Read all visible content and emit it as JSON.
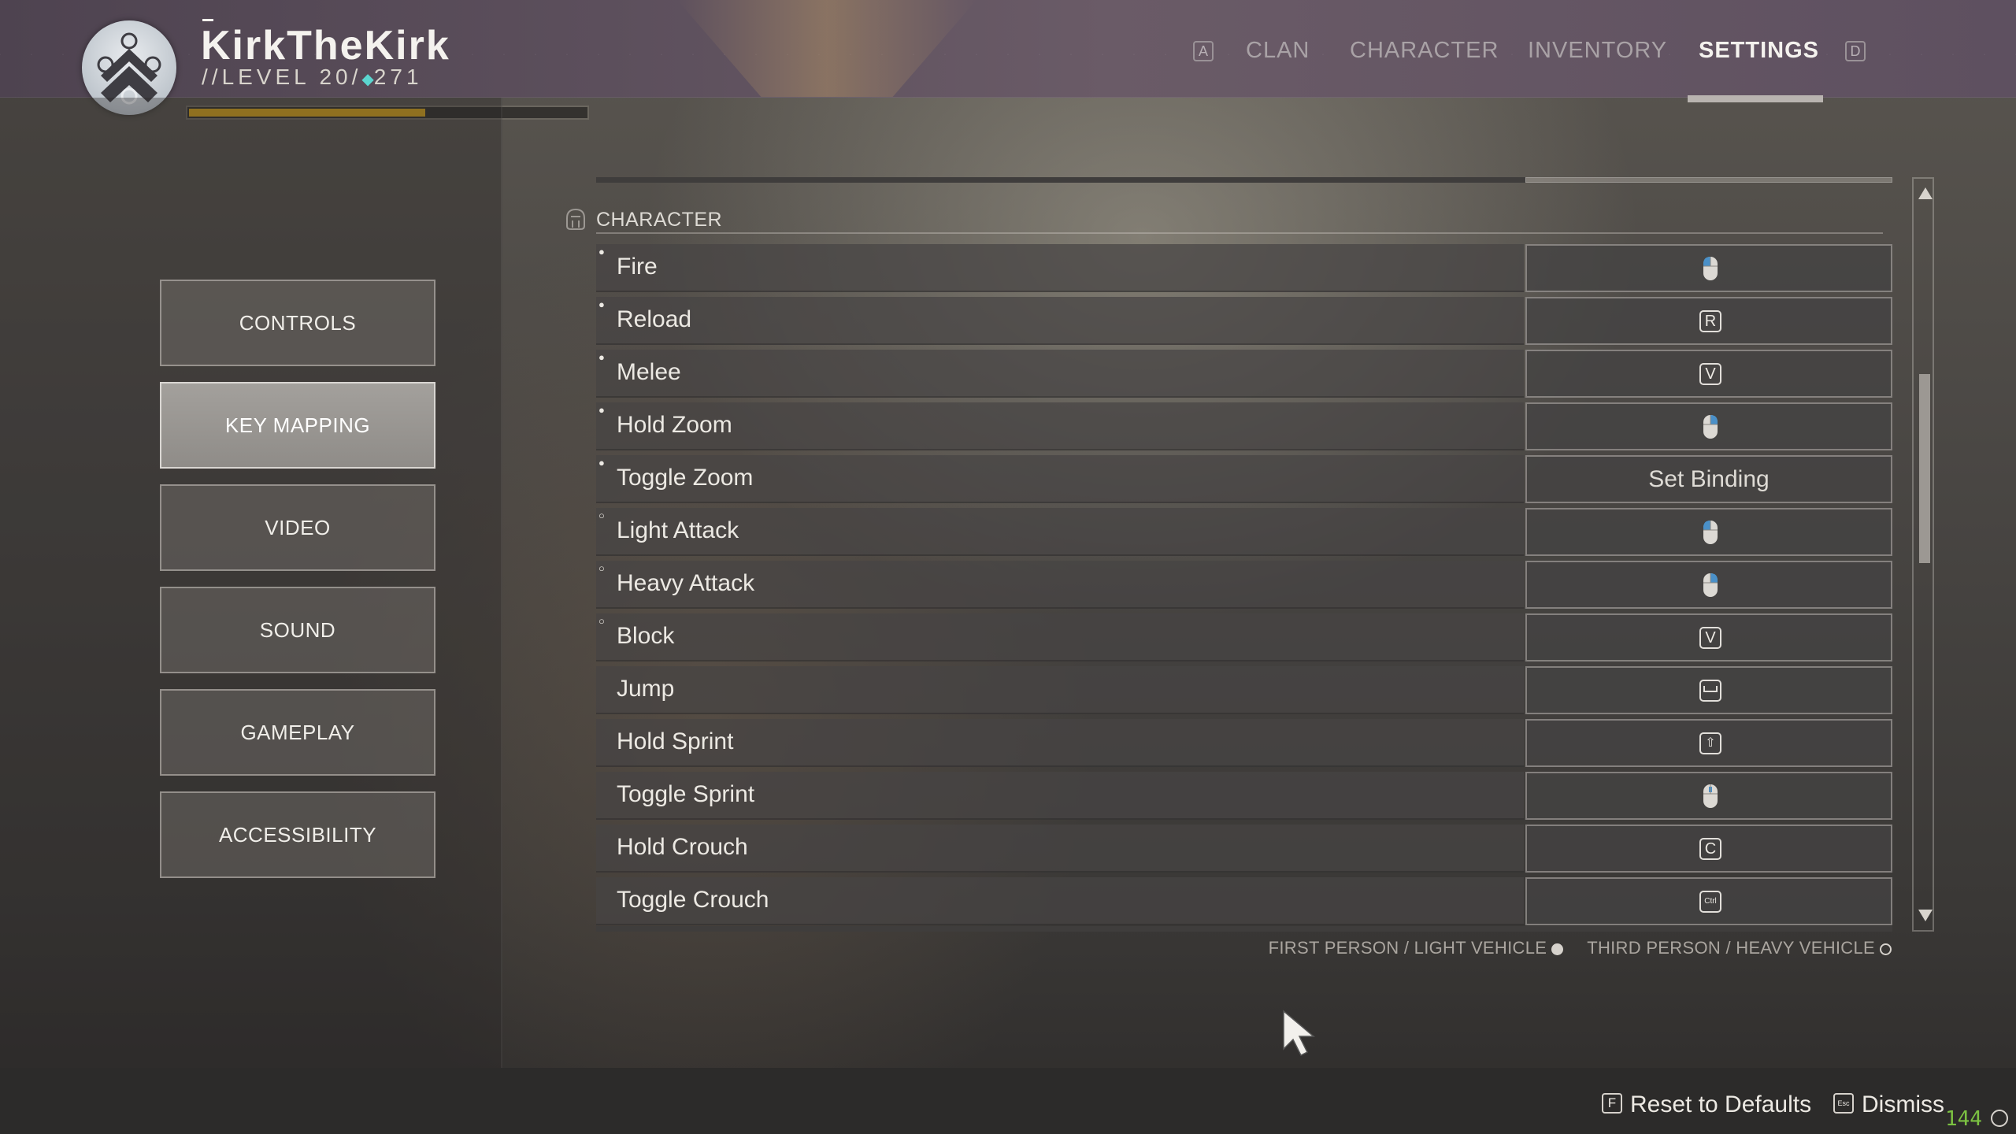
{
  "header": {
    "player_name": "KirkTheKirk",
    "level_prefix": "//",
    "level_text": "LEVEL 20/",
    "power_icon": "diamond-icon",
    "power": "271",
    "xp_progress": 0.59,
    "nav_left_key": "A",
    "nav_right_key": "D",
    "tabs": [
      {
        "label": "CLAN"
      },
      {
        "label": "CHARACTER"
      },
      {
        "label": "INVENTORY"
      },
      {
        "label": "SETTINGS",
        "active": true
      }
    ]
  },
  "sidebar": {
    "items": [
      {
        "label": "CONTROLS"
      },
      {
        "label": "KEY MAPPING",
        "active": true
      },
      {
        "label": "VIDEO"
      },
      {
        "label": "SOUND"
      },
      {
        "label": "GAMEPLAY"
      },
      {
        "label": "ACCESSIBILITY"
      }
    ]
  },
  "section": {
    "title": "CHARACTER",
    "icon": "helmet-icon"
  },
  "bindings": [
    {
      "action": "Fire",
      "marker": "filled",
      "binding_type": "mouse",
      "binding": "left-mouse-icon"
    },
    {
      "action": "Reload",
      "marker": "filled",
      "binding_type": "key",
      "binding": "R"
    },
    {
      "action": "Melee",
      "marker": "filled",
      "binding_type": "key",
      "binding": "V"
    },
    {
      "action": "Hold Zoom",
      "marker": "filled",
      "binding_type": "mouse",
      "binding": "right-mouse-icon"
    },
    {
      "action": "Toggle Zoom",
      "marker": "filled",
      "binding_type": "text",
      "binding": "Set Binding"
    },
    {
      "action": "Light Attack",
      "marker": "hollow",
      "binding_type": "mouse",
      "binding": "left-mouse-icon"
    },
    {
      "action": "Heavy Attack",
      "marker": "hollow",
      "binding_type": "mouse",
      "binding": "right-mouse-icon"
    },
    {
      "action": "Block",
      "marker": "hollow",
      "binding_type": "key",
      "binding": "V"
    },
    {
      "action": "Jump",
      "marker": "",
      "binding_type": "key",
      "binding": "space-key-icon"
    },
    {
      "action": "Hold Sprint",
      "marker": "",
      "binding_type": "key",
      "binding": "shift-key-icon"
    },
    {
      "action": "Toggle Sprint",
      "marker": "",
      "binding_type": "mouse",
      "binding": "middle-mouse-icon"
    },
    {
      "action": "Hold Crouch",
      "marker": "",
      "binding_type": "key",
      "binding": "C"
    },
    {
      "action": "Toggle Crouch",
      "marker": "",
      "binding_type": "key",
      "binding": "Ctrl"
    }
  ],
  "legend": {
    "first": "FIRST PERSON / LIGHT VEHICLE",
    "second": "THIRD PERSON / HEAVY VEHICLE"
  },
  "footer": {
    "reset_key": "F",
    "reset_label": "Reset to Defaults",
    "dismiss_key": "Esc",
    "dismiss_label": "Dismiss",
    "fps": "144"
  }
}
